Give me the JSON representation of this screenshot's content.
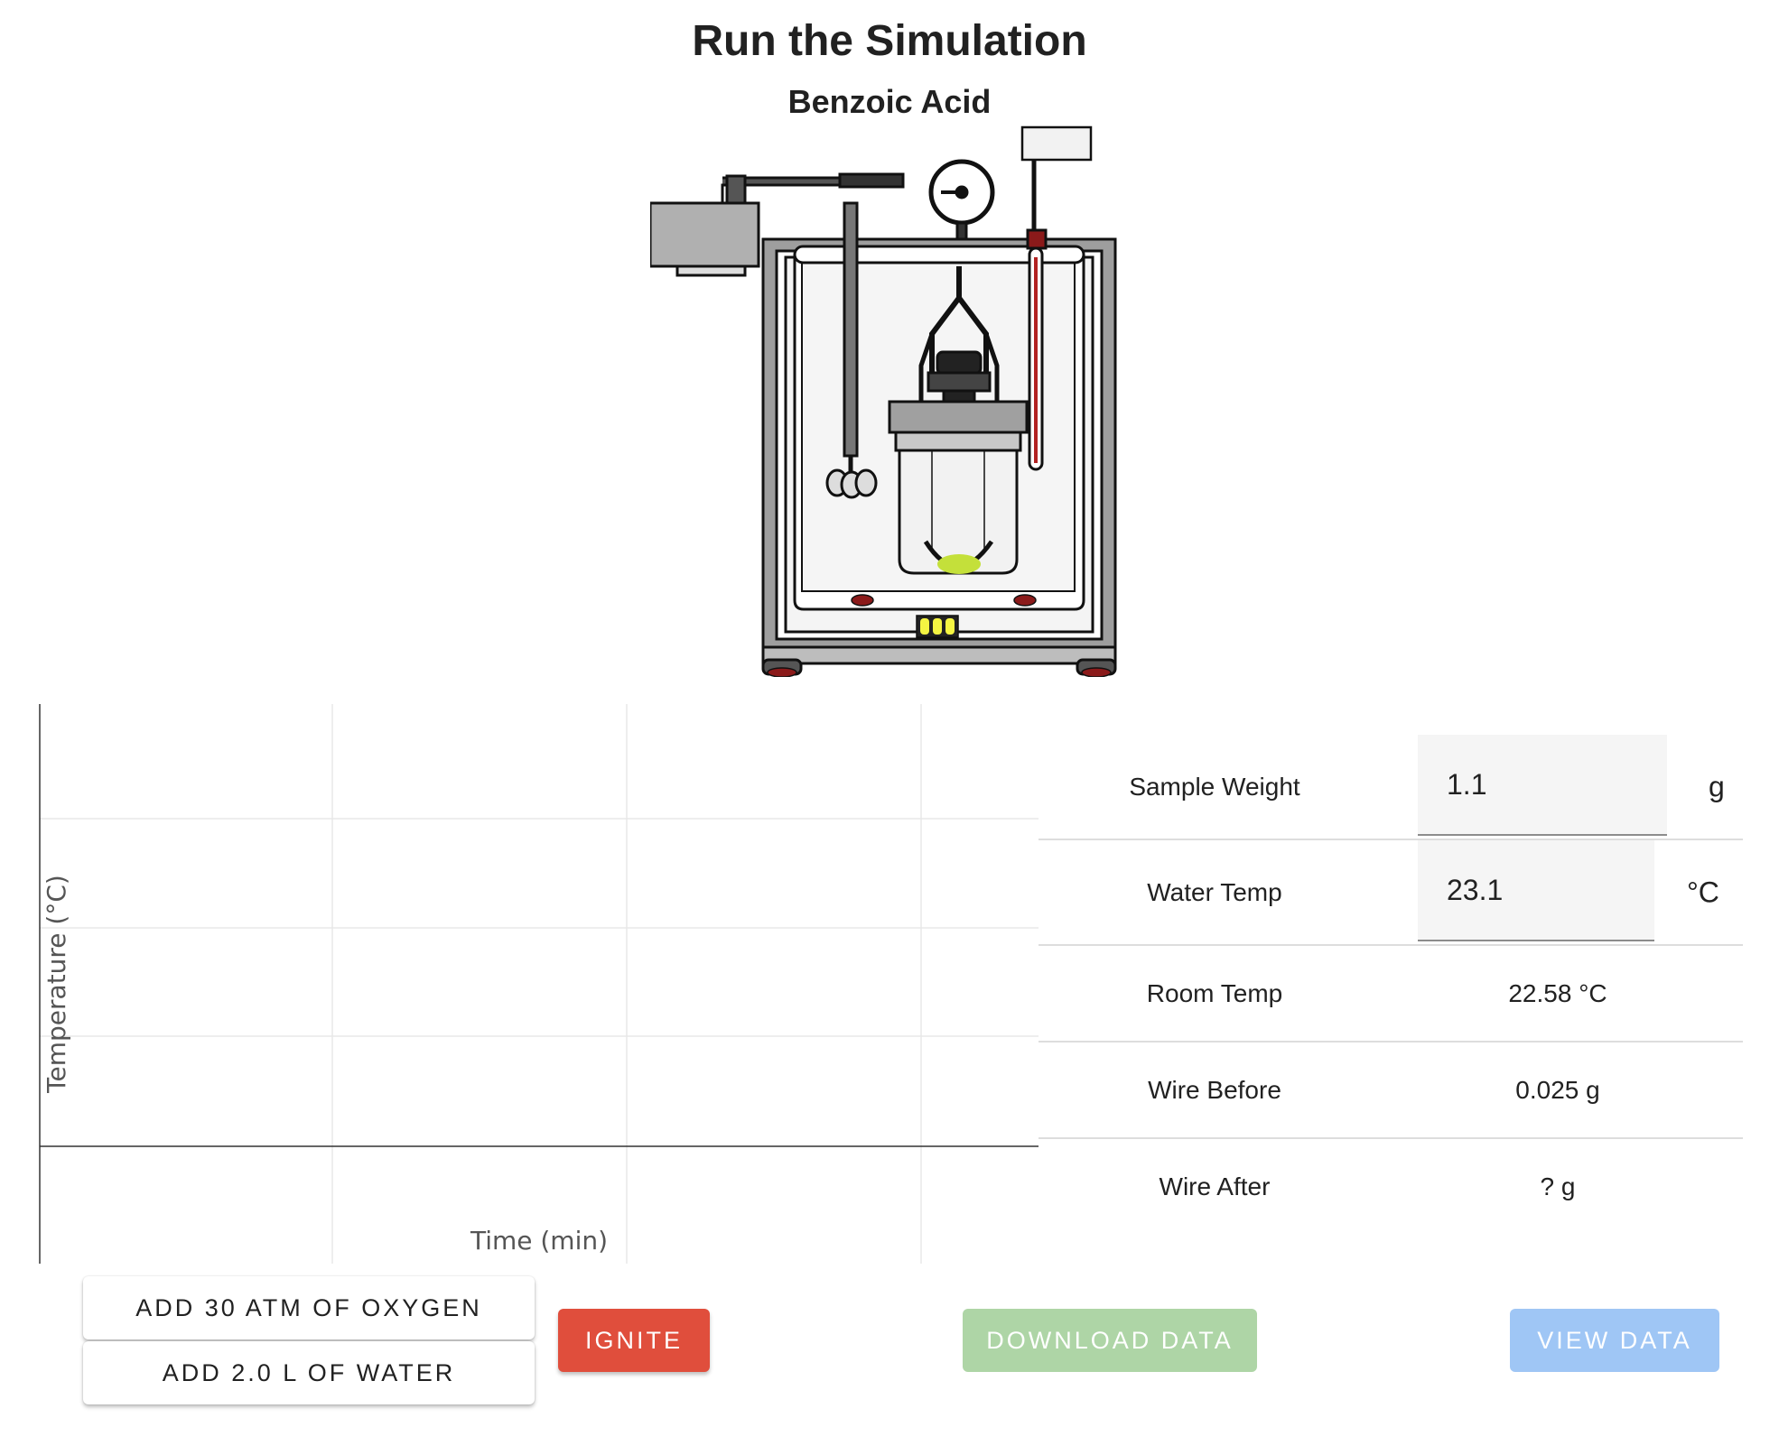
{
  "header": {
    "title": "Run the Simulation",
    "subtitle": "Benzoic Acid"
  },
  "chart": {
    "xlabel": "Time (min)",
    "ylabel": "Temperature (°C)"
  },
  "chart_data": {
    "type": "line",
    "title": "",
    "xlabel": "Time (min)",
    "ylabel": "Temperature (°C)",
    "series": [],
    "grid": true,
    "legend": "none"
  },
  "table": {
    "sample_weight": {
      "label": "Sample Weight",
      "value": "1.1",
      "unit": "g"
    },
    "water_temp": {
      "label": "Water Temp",
      "value": "23.1",
      "unit": "°C"
    },
    "room_temp": {
      "label": "Room Temp",
      "value": "22.58 °C"
    },
    "wire_before": {
      "label": "Wire Before",
      "value": "0.025 g"
    },
    "wire_after": {
      "label": "Wire After",
      "value": "? g"
    }
  },
  "buttons": {
    "oxygen": "Add 30 atm of Oxygen",
    "water": "Add 2.0 L of Water",
    "ignite": "Ignite",
    "download": "Download Data",
    "view": "View Data"
  },
  "colors": {
    "ignite": "#e04e3c",
    "download_disabled": "#aed5a6",
    "view_disabled": "#9fc6f5",
    "sample_pellet": "#c4e03a",
    "indicator_lights": "#f5f542"
  }
}
